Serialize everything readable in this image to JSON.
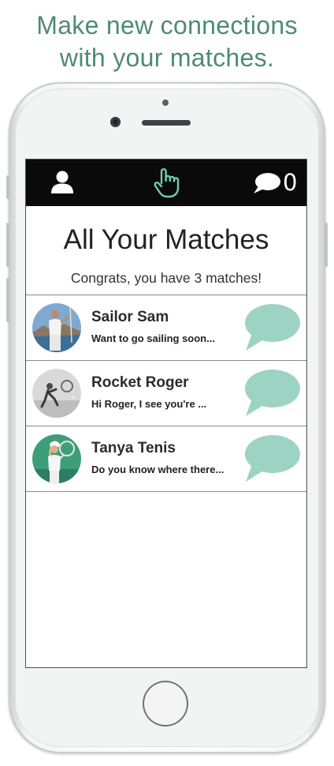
{
  "headline": {
    "line1": "Make new connections",
    "line2": "with your matches."
  },
  "topbar": {
    "left_icon": "profile-icon",
    "center_icon": "pointing-hand-icon",
    "right_icon": "speech-bubble-icon",
    "message_count": "0"
  },
  "screen": {
    "title": "All Your Matches",
    "subtitle": "Congrats, you have 3 matches!"
  },
  "matches": [
    {
      "name": "Sailor Sam",
      "message": "Want to go sailing soon..."
    },
    {
      "name": "Rocket Roger",
      "message": "Hi Roger, I see you're ..."
    },
    {
      "name": "Tanya Tenis",
      "message": "Do you know where there..."
    }
  ],
  "colors": {
    "accent": "#4e8a78",
    "bubble": "#9dd3c2",
    "topbar": "#0a0a0a"
  }
}
